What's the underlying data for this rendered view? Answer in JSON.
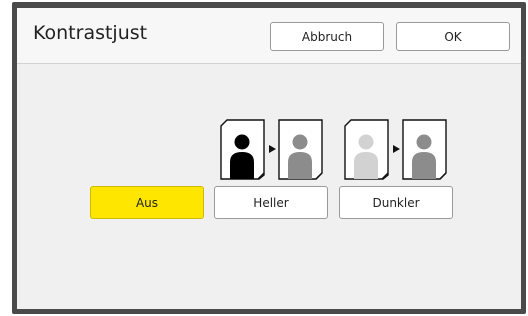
{
  "dialog": {
    "title": "Kontrastjust",
    "cancel_label": "Abbruch",
    "ok_label": "OK"
  },
  "options": {
    "selected": "Aus",
    "aus_label": "Aus",
    "heller_label": "Heller",
    "dunkler_label": "Dunkler"
  },
  "colors": {
    "selected_accent": "#ffe600",
    "frame": "#4a4a4a",
    "panel": "#f0f0f0"
  },
  "icons": {
    "heller": [
      "document-black-person-icon",
      "arrow-right-icon",
      "document-gray-person-icon"
    ],
    "dunkler": [
      "document-lightgray-person-icon",
      "arrow-right-icon",
      "document-gray-person-icon"
    ]
  }
}
